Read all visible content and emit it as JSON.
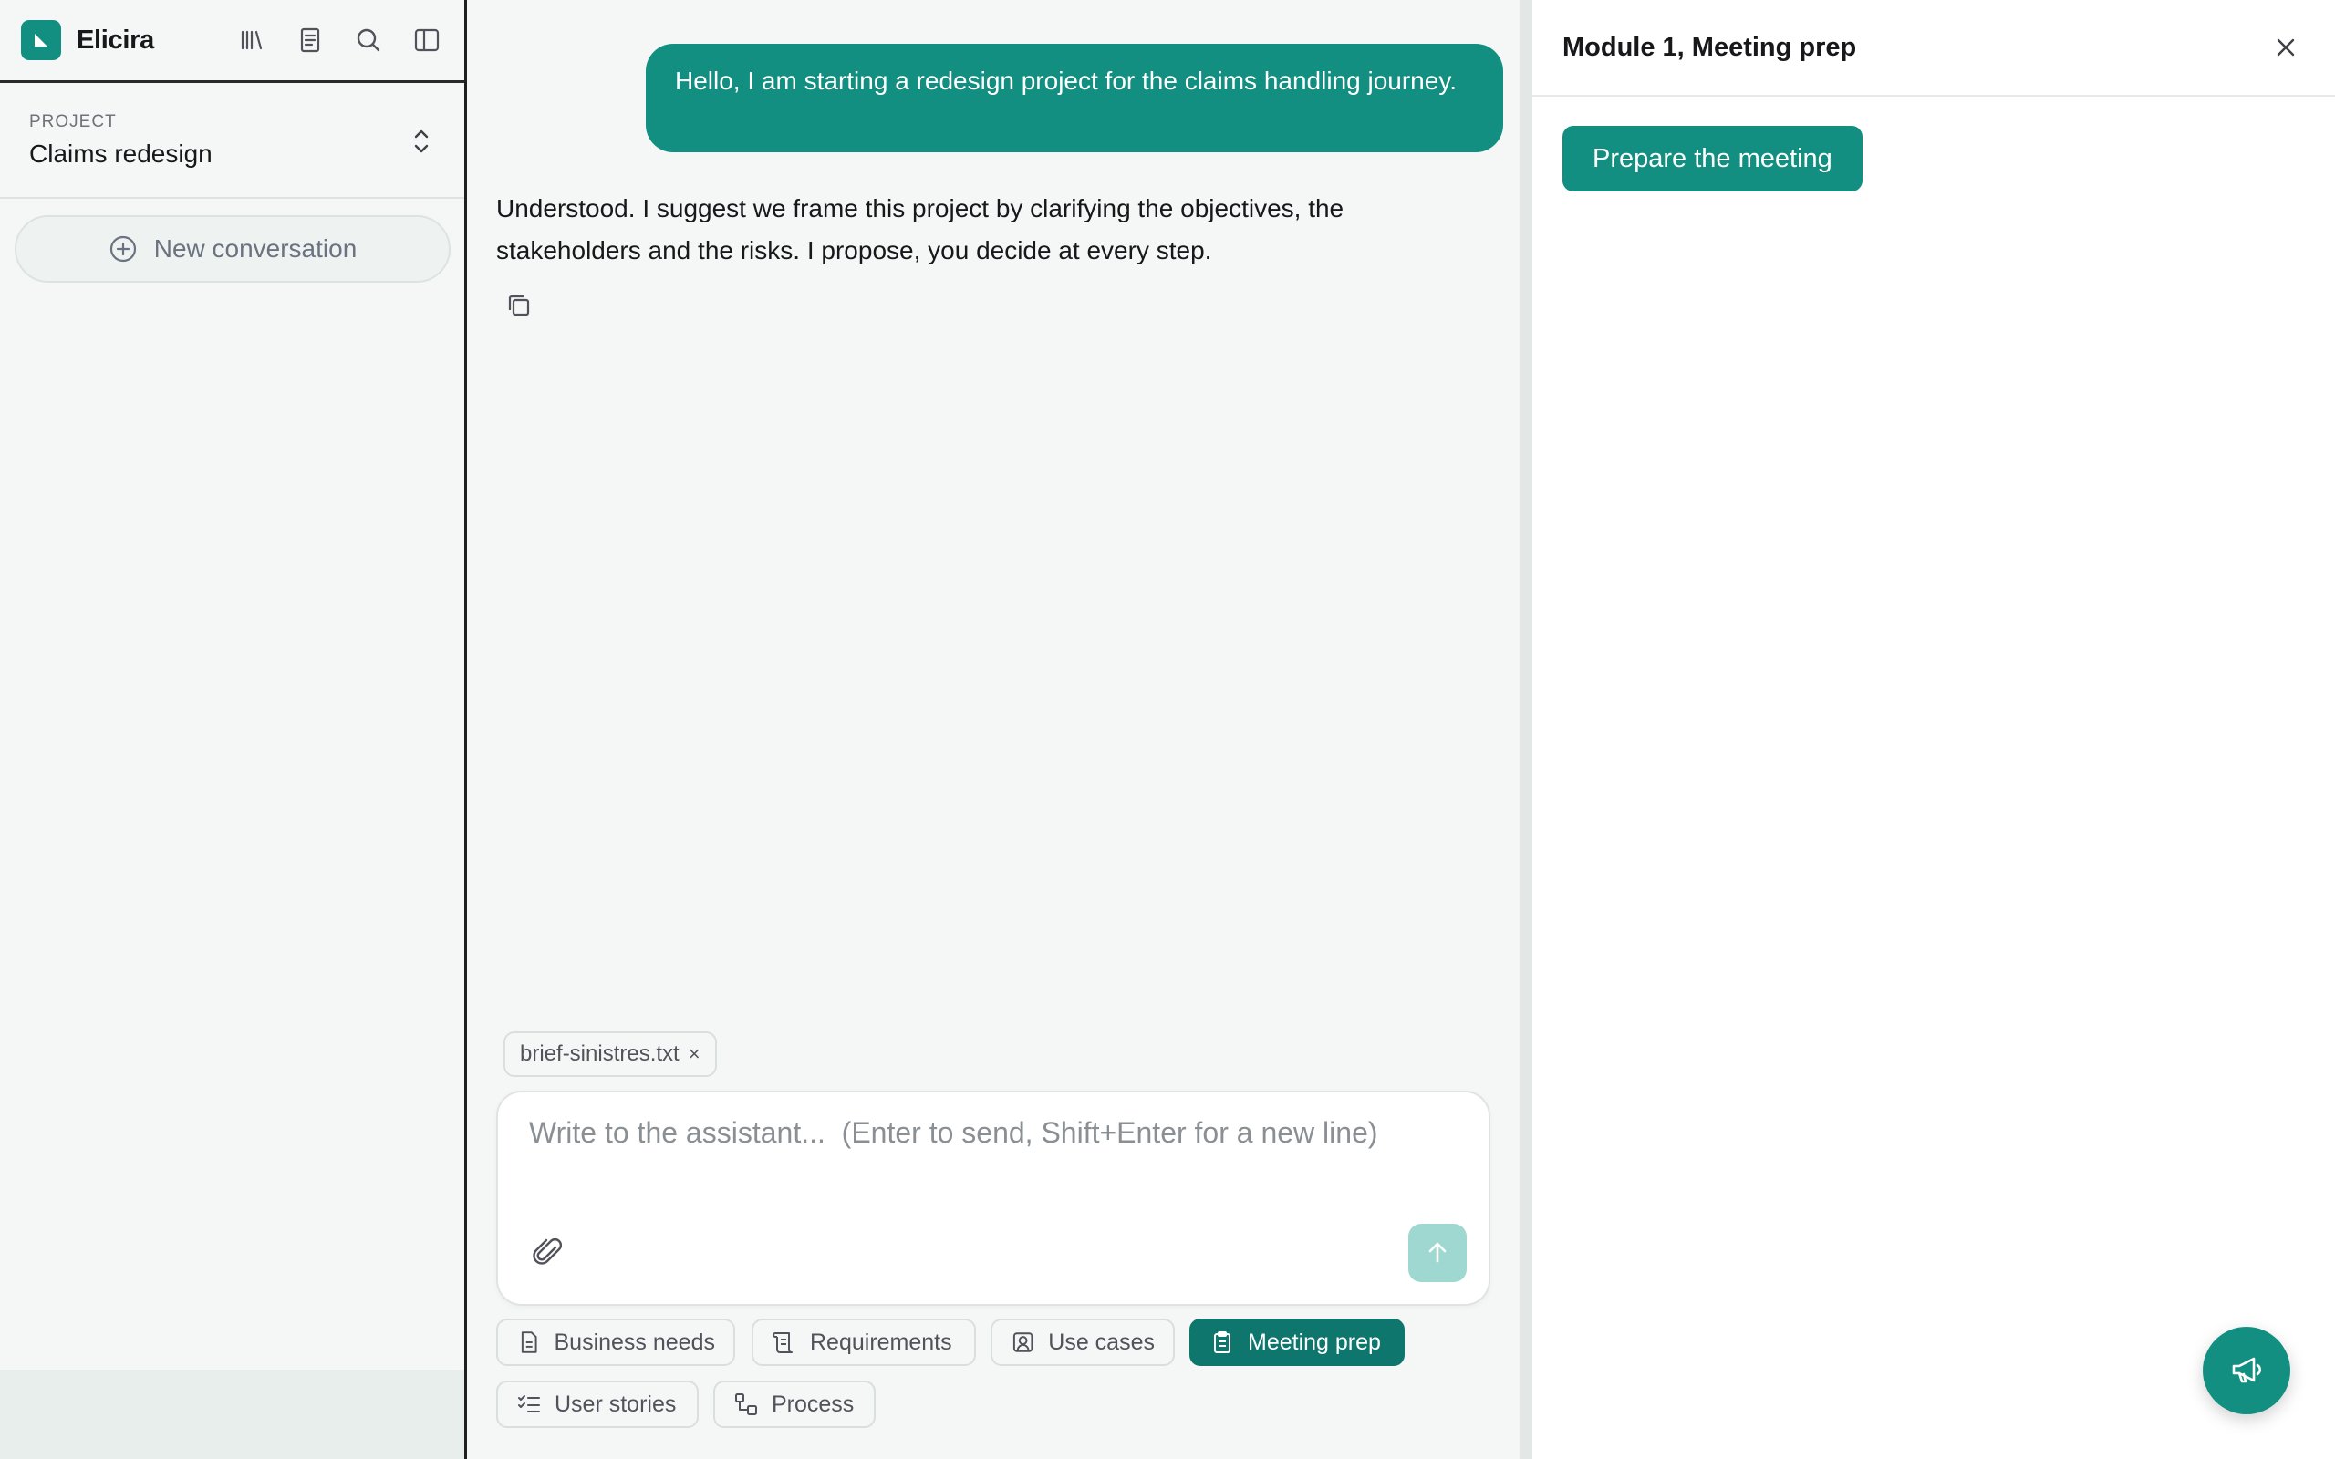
{
  "colors": {
    "brand": "#128f80",
    "brand_dark": "#0f766e",
    "send_disabled": "#9fd8d0"
  },
  "sidebar": {
    "app_name": "Elicira",
    "icons": [
      "library-icon",
      "notes-icon",
      "search-icon",
      "sidebar-toggle-icon"
    ],
    "project_kicker": "PROJECT",
    "project_name": "Claims redesign",
    "new_conversation": "New conversation"
  },
  "chat": {
    "user_message": "Hello, I am starting a redesign project for the claims handling journey.",
    "assistant_message": "Understood. I suggest we frame this project by clarifying the objectives, the stakeholders and the risks. I propose, you decide at every step.",
    "attachment": "brief-sinistres.txt",
    "attachment_remove": "×",
    "composer_placeholder": "Write to the assistant...  (Enter to send, Shift+Enter for a new line)",
    "modules": [
      {
        "label": "Business needs",
        "icon": "document-icon",
        "active": false
      },
      {
        "label": "Requirements",
        "icon": "scroll-icon",
        "active": false
      },
      {
        "label": "Use cases",
        "icon": "user-card-icon",
        "active": false
      },
      {
        "label": "Meeting prep",
        "icon": "clipboard-icon",
        "active": true
      },
      {
        "label": "User stories",
        "icon": "checklist-icon",
        "active": false
      },
      {
        "label": "Process",
        "icon": "flow-icon",
        "active": false
      }
    ]
  },
  "panel": {
    "title": "Module 1, Meeting prep",
    "prepare_button": "Prepare the meeting"
  }
}
